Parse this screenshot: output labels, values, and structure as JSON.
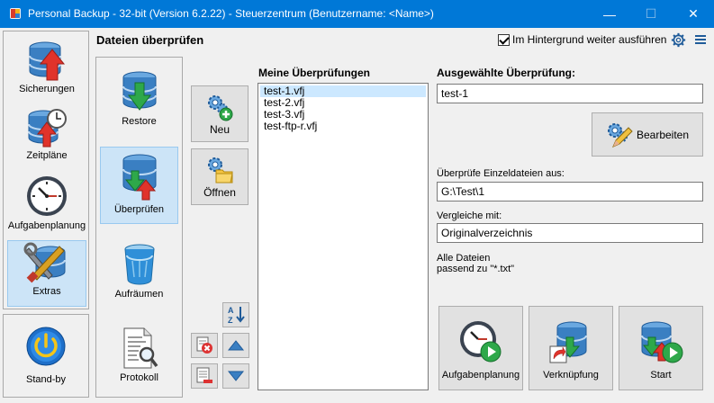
{
  "window": {
    "title": "Personal Backup - 32-bit (Version 6.2.22) - Steuerzentrum (Benutzername: <Name>)",
    "min_glyph": "—",
    "max_glyph": "☐",
    "close_glyph": "✕"
  },
  "sidebar": {
    "items": [
      {
        "label": "Sicherungen",
        "icon": "database-upload-icon"
      },
      {
        "label": "Zeitpläne",
        "icon": "database-clock-icon"
      },
      {
        "label": "Aufgabenplanung",
        "icon": "clock-icon"
      },
      {
        "label": "Extras",
        "icon": "tools-database-icon",
        "active": true
      }
    ],
    "standby": {
      "label": "Stand-by",
      "icon": "power-icon"
    }
  },
  "header": {
    "title": "Dateien überprüfen",
    "background_label": "Im Hintergrund weiter ausführen",
    "background_checked": true
  },
  "subnav": {
    "items": [
      {
        "label": "Restore",
        "icon": "database-download-icon"
      },
      {
        "label": "Überprüfen",
        "icon": "database-verify-icon",
        "active": true
      },
      {
        "label": "Aufräumen",
        "icon": "trash-bin-icon"
      },
      {
        "label": "Protokoll",
        "icon": "document-search-icon"
      }
    ]
  },
  "actions": {
    "new_label": "Neu",
    "open_label": "Öffnen"
  },
  "list": {
    "title": "Meine Überprüfungen",
    "items": [
      "test-1.vfj",
      "test-2.vfj",
      "test-3.vfj",
      "test-ftp-r.vfj"
    ],
    "selected": 0
  },
  "detail": {
    "selected_title": "Ausgewählte Überprüfung:",
    "selected_value": "test-1",
    "edit_label": "Bearbeiten",
    "single_files_label": "Überprüfe Einzeldateien aus:",
    "single_files_value": "G:\\Test\\1",
    "compare_label": "Vergleiche mit:",
    "compare_value": "Originalverzeichnis",
    "info_line1": "Alle Dateien",
    "info_line2": "passend zu \"*.txt\""
  },
  "bottom_buttons": {
    "schedule_label": "Aufgabenplanung",
    "link_label": "Verknüpfung",
    "start_label": "Start"
  },
  "colors": {
    "titlebar": "#0078d7",
    "active_bg": "#cce4f7",
    "db_blue": "#3a7fc2",
    "arrow_red": "#e0332b",
    "arrow_green": "#2ea84a"
  }
}
